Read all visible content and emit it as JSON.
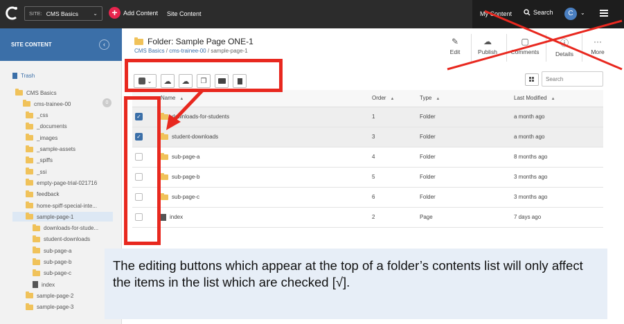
{
  "topbar": {
    "site_tag": "SITE:",
    "site_name": "CMS Basics",
    "add_content": "Add Content",
    "site_content": "Site Content",
    "my_content": "My Content",
    "search": "Search",
    "avatar_initial": "C"
  },
  "sidebar": {
    "title": "SITE CONTENT",
    "trash": "Trash",
    "trash_count": "0",
    "tree": [
      {
        "label": "CMS Basics",
        "icon": "folder-icon"
      },
      {
        "label": "cms-trainee-00",
        "icon": "folder-icon"
      },
      {
        "label": "_css",
        "icon": "folder-icon"
      },
      {
        "label": "_documents",
        "icon": "folder-icon"
      },
      {
        "label": "_images",
        "icon": "folder-icon"
      },
      {
        "label": "_sample-assets",
        "icon": "folder-icon"
      },
      {
        "label": "_spiffs",
        "icon": "folder-icon"
      },
      {
        "label": "_ssi",
        "icon": "folder-icon"
      },
      {
        "label": "empty-page-trial-021716",
        "icon": "folder-icon"
      },
      {
        "label": "feedback",
        "icon": "folder-icon"
      },
      {
        "label": "home-spiff-special-inte...",
        "icon": "folder-icon"
      },
      {
        "label": "sample-page-1",
        "icon": "folder-icon"
      },
      {
        "label": "downloads-for-stude...",
        "icon": "folder-icon"
      },
      {
        "label": "student-downloads",
        "icon": "folder-icon"
      },
      {
        "label": "sub-page-a",
        "icon": "folder-icon"
      },
      {
        "label": "sub-page-b",
        "icon": "folder-icon"
      },
      {
        "label": "sub-page-c",
        "icon": "folder-icon"
      },
      {
        "label": "index",
        "icon": "page-icon"
      },
      {
        "label": "sample-page-2",
        "icon": "folder-icon"
      },
      {
        "label": "sample-page-3",
        "icon": "folder-icon"
      }
    ]
  },
  "main": {
    "title": "Folder: Sample Page ONE-1",
    "breadcrumb": [
      "CMS Basics",
      "cms-trainee-00",
      "sample-page-1"
    ],
    "breadcrumb_sep": "/",
    "actions": [
      "Edit",
      "Publish",
      "Comments",
      "Details",
      "More"
    ],
    "search_placeholder": "Search",
    "columns": [
      "Name",
      "Order",
      "Type",
      "Last Modified"
    ],
    "rows": [
      {
        "checked": true,
        "name": "downloads-for-students",
        "order": "1",
        "type": "Folder",
        "modified": "a month ago"
      },
      {
        "checked": true,
        "name": "student-downloads",
        "order": "3",
        "type": "Folder",
        "modified": "a month ago"
      },
      {
        "checked": false,
        "name": "sub-page-a",
        "order": "4",
        "type": "Folder",
        "modified": "8 months ago"
      },
      {
        "checked": false,
        "name": "sub-page-b",
        "order": "5",
        "type": "Folder",
        "modified": "3 months ago"
      },
      {
        "checked": false,
        "name": "sub-page-c",
        "order": "6",
        "type": "Folder",
        "modified": "3 months ago"
      },
      {
        "checked": false,
        "name": "index",
        "order": "2",
        "type": "Page",
        "modified": "7 days ago"
      }
    ]
  },
  "annotation": {
    "text": "The editing buttons which appear at the top of a folder’s contents list will only affect the items in the list which are checked [√].",
    "color": "#e8281f"
  }
}
